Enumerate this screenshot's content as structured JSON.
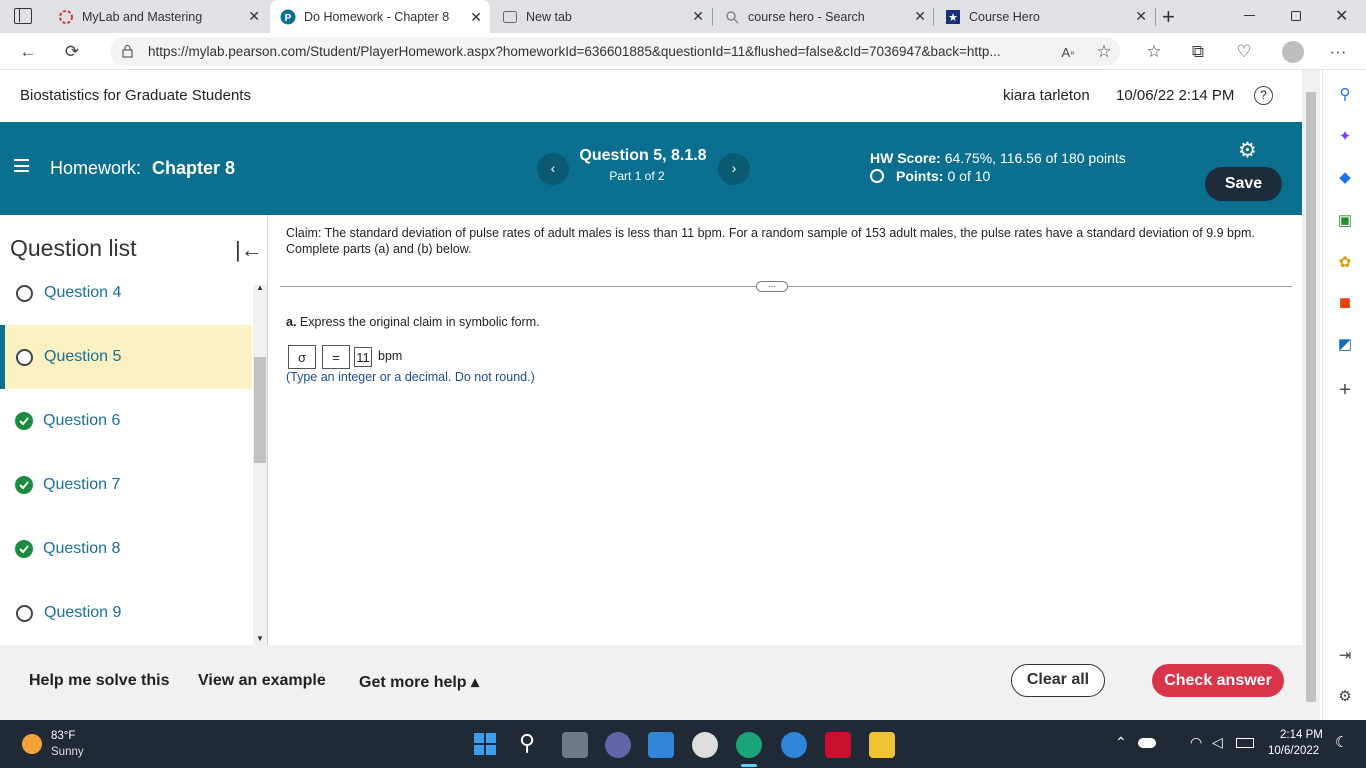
{
  "browser": {
    "tabs": [
      {
        "title": "MyLab and Mastering",
        "icon": "loading-icon",
        "active": false
      },
      {
        "title": "Do Homework - Chapter 8",
        "icon": "pearson-icon",
        "active": true
      },
      {
        "title": "New tab",
        "icon": "newtab-icon",
        "active": false
      },
      {
        "title": "course hero - Search",
        "icon": "search-icon",
        "active": false
      },
      {
        "title": "Course Hero",
        "icon": "coursehero-icon",
        "active": false
      }
    ],
    "url": "https://mylab.pearson.com/Student/PlayerHomework.aspx?homeworkId=636601885&questionId=11&flushed=false&cId=7036947&back=http..."
  },
  "course": {
    "title": "Biostatistics for Graduate Students",
    "user": "kiara tarleton",
    "datetime": "10/06/22 2:14 PM"
  },
  "homework": {
    "label": "Homework:",
    "name": "Chapter 8",
    "question_title": "Question 5, 8.1.8",
    "part": "Part 1 of 2",
    "hw_score_label": "HW Score:",
    "hw_score_value": "64.75%, 116.56 of 180 points",
    "points_label": "Points:",
    "points_value": "0 of 10",
    "save_label": "Save"
  },
  "question_list": {
    "heading": "Question list",
    "items": [
      {
        "label": "Question 4",
        "status": "open"
      },
      {
        "label": "Question 5",
        "status": "current"
      },
      {
        "label": "Question 6",
        "status": "done"
      },
      {
        "label": "Question 7",
        "status": "done"
      },
      {
        "label": "Question 8",
        "status": "done"
      },
      {
        "label": "Question 9",
        "status": "open"
      }
    ]
  },
  "question": {
    "claim": "Claim: The standard deviation of pulse rates of adult males is less than 11 bpm. For a random sample of 153 adult males, the pulse rates have a standard deviation of 9.9 bpm. Complete parts (a) and (b) below.",
    "part_a_label": "a.",
    "part_a_text": "Express the original claim in symbolic form.",
    "symbol": "σ",
    "operator": "=",
    "value": "11",
    "unit": "bpm",
    "hint": "(Type an integer or a decimal. Do not round.)",
    "more": "···"
  },
  "footer": {
    "help_solve": "Help me solve this",
    "view_example": "View an example",
    "get_help": "Get more help ▴",
    "clear_all": "Clear all",
    "check_answer": "Check answer"
  },
  "taskbar": {
    "temp": "83°F",
    "weather": "Sunny",
    "time": "2:14 PM",
    "date": "10/6/2022"
  },
  "colors": {
    "header_teal": "#0b6f8f",
    "save_bg": "#1d2b3a",
    "check_red": "#d8354a",
    "current_highlight": "#fbf0c2",
    "done_green": "#1d8a3d"
  }
}
